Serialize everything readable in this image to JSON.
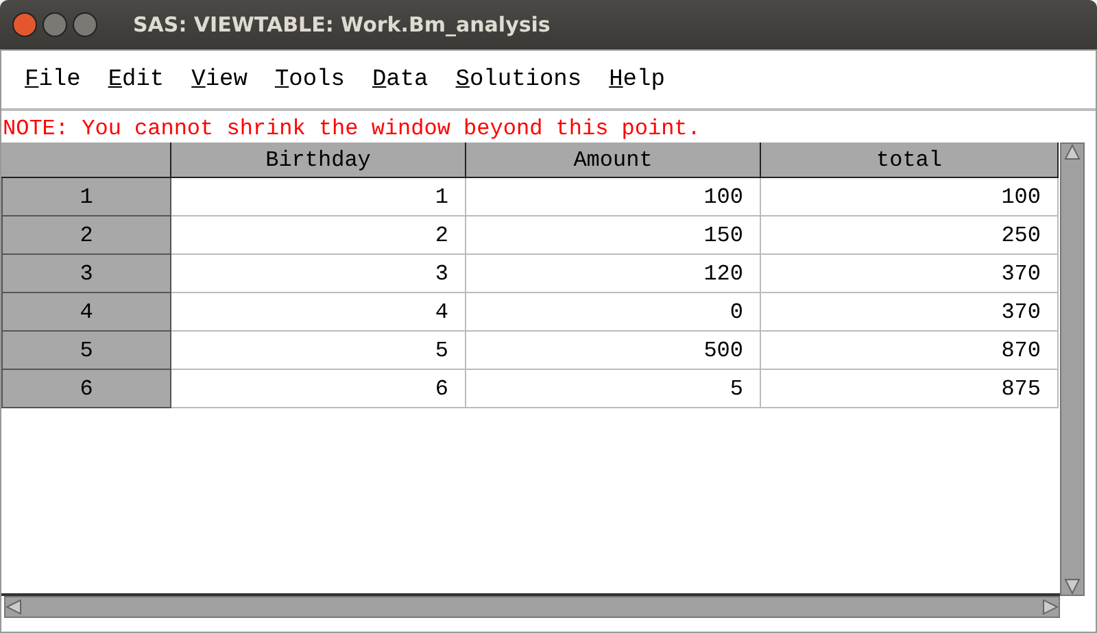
{
  "window": {
    "title": "SAS: VIEWTABLE: Work.Bm_analysis"
  },
  "menu": [
    "File",
    "Edit",
    "View",
    "Tools",
    "Data",
    "Solutions",
    "Help"
  ],
  "note": "NOTE: You cannot shrink the window beyond this point.",
  "table": {
    "columns": [
      "Birthday",
      "Amount",
      "total"
    ],
    "rows": [
      {
        "label": "1",
        "cells": [
          "1",
          "100",
          "100"
        ]
      },
      {
        "label": "2",
        "cells": [
          "2",
          "150",
          "250"
        ]
      },
      {
        "label": "3",
        "cells": [
          "3",
          "120",
          "370"
        ]
      },
      {
        "label": "4",
        "cells": [
          "4",
          "0",
          "370"
        ]
      },
      {
        "label": "5",
        "cells": [
          "5",
          "500",
          "870"
        ]
      },
      {
        "label": "6",
        "cells": [
          "6",
          "5",
          "875"
        ]
      }
    ]
  }
}
